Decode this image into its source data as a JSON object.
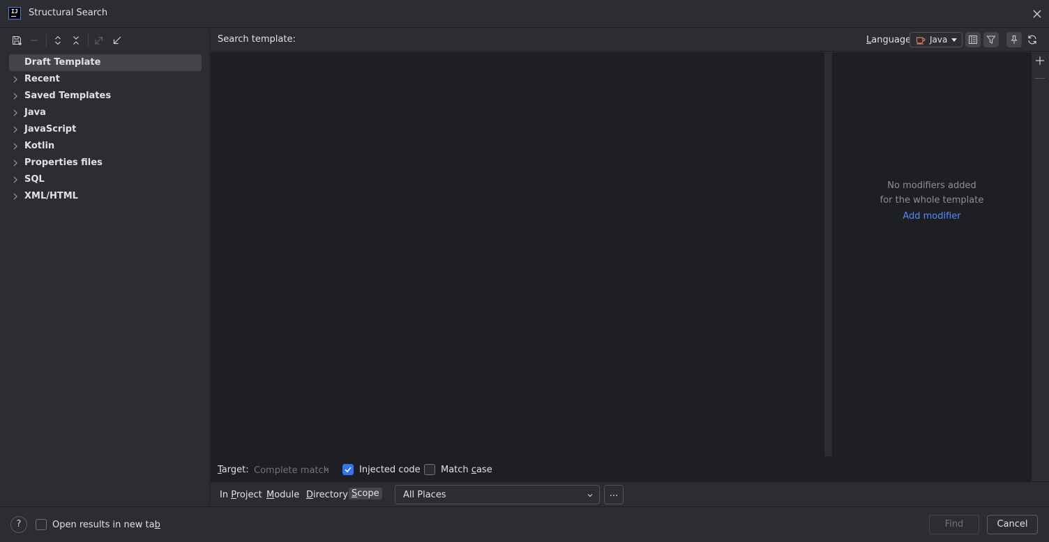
{
  "window": {
    "title": "Structural Search",
    "logo_text": "IJ"
  },
  "tree": {
    "items": [
      {
        "label": "Draft Template",
        "expandable": false,
        "selected": true
      },
      {
        "label": "Recent",
        "expandable": true
      },
      {
        "label": "Saved Templates",
        "expandable": true
      },
      {
        "label": "Java",
        "expandable": true
      },
      {
        "label": "JavaScript",
        "expandable": true
      },
      {
        "label": "Kotlin",
        "expandable": true
      },
      {
        "label": "Properties files",
        "expandable": true
      },
      {
        "label": "SQL",
        "expandable": true
      },
      {
        "label": "XML/HTML",
        "expandable": true
      }
    ]
  },
  "header": {
    "search_template_label": "Search template:",
    "language_label_prefix": "L",
    "language_label_rest": "anguage:",
    "language_value": "Java"
  },
  "modifiers": {
    "line1": "No modifiers added",
    "line2": "for the whole template",
    "add_link": "Add modifier"
  },
  "options": {
    "target_label_first": "T",
    "target_label_rest": "arget:",
    "target_value": "Complete match",
    "injected_code_label": "Injected code",
    "injected_code_checked": true,
    "match_case_prefix": "Match ",
    "match_case_underlined": "c",
    "match_case_rest": "ase",
    "match_case_checked": false
  },
  "scope": {
    "tabs": [
      {
        "before": "In ",
        "underlined": "P",
        "after": "roject",
        "active": false
      },
      {
        "before": "",
        "underlined": "M",
        "after": "odule",
        "active": false
      },
      {
        "before": "",
        "underlined": "D",
        "after": "irectory",
        "active": false
      },
      {
        "before": "",
        "underlined": "S",
        "after": "cope",
        "active": true
      }
    ],
    "selected": "All Places",
    "more_label": "..."
  },
  "bottom": {
    "help_label": "?",
    "open_results_prefix": "Open results in new ta",
    "open_results_underlined": "b",
    "open_results_checked": false,
    "find_label": "Find",
    "cancel_label": "Cancel"
  },
  "colors": {
    "background": "#2b2d30",
    "editor": "#1e1f22",
    "accent": "#3574f0",
    "link": "#548af7",
    "muted": "#8c8f94"
  }
}
